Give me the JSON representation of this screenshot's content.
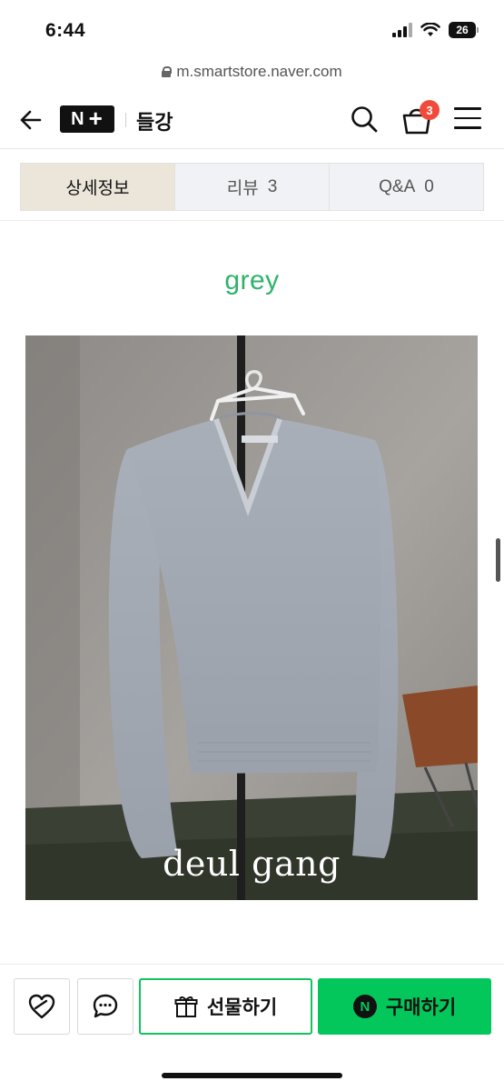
{
  "status_bar": {
    "time": "6:44",
    "battery": "26"
  },
  "browser": {
    "url": "m.smartstore.naver.com"
  },
  "header": {
    "logo_text": "N",
    "logo_plus": "+",
    "store_name": "들강",
    "cart_count": "3",
    "icons": [
      "back-arrow-icon",
      "search-icon",
      "cart-icon",
      "menu-icon"
    ]
  },
  "tabs": [
    {
      "label": "상세정보",
      "count": ""
    },
    {
      "label": "리뷰",
      "count": "3"
    },
    {
      "label": "Q&A",
      "count": "0"
    }
  ],
  "content": {
    "color_label": "grey",
    "photo_caption": "deul gang"
  },
  "bottom_bar": {
    "gift_label": "선물하기",
    "buy_label": "구매하기",
    "buy_badge": "N"
  },
  "colors": {
    "accent_green": "#03c75a",
    "label_green": "#2fb36a",
    "badge_red": "#f04b3a",
    "active_tab": "#ece5da"
  }
}
